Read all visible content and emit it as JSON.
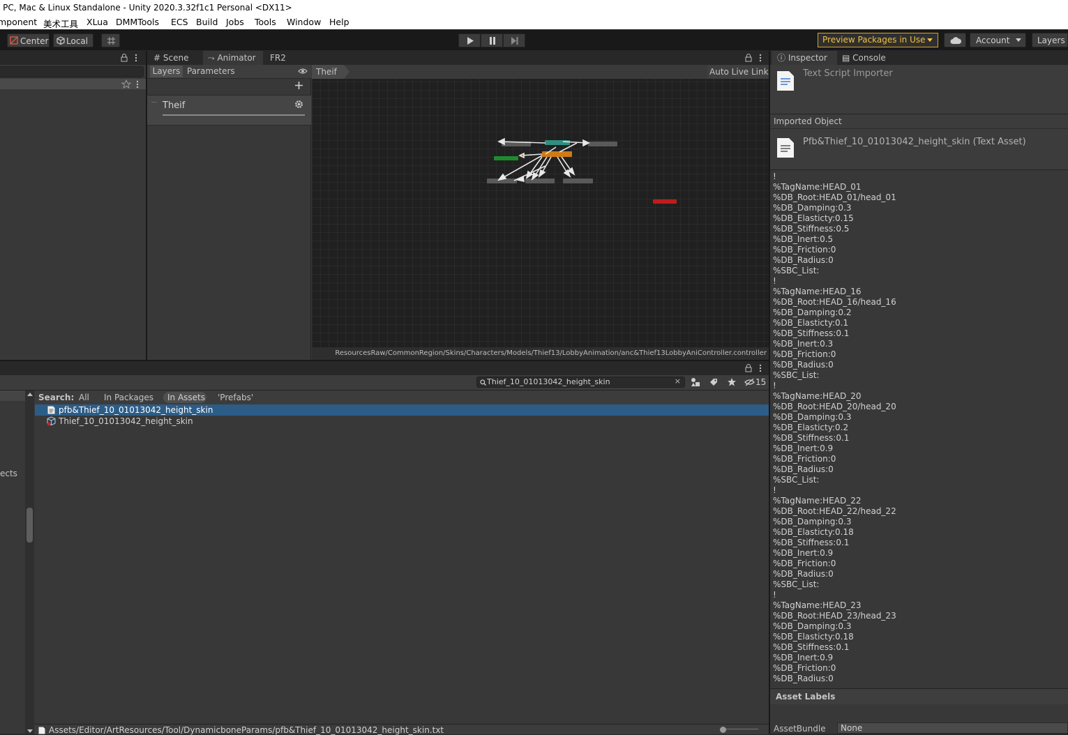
{
  "window": {
    "title": "- PC, Mac & Linux Standalone - Unity 2020.3.32f1c1 Personal <DX11>"
  },
  "menu": [
    "mponent",
    "美术工具",
    "XLua",
    "DMMTools",
    "ECS",
    "Build",
    "Jobs",
    "Tools",
    "Window",
    "Help"
  ],
  "toolbar": {
    "pivot_center": "Center",
    "pivot_local": "Local",
    "preview_packages": "Preview Packages in Use",
    "account": "Account",
    "layers": "Layers"
  },
  "animator": {
    "tabs": [
      "Scene",
      "Animator",
      "FR2"
    ],
    "subtabs": [
      "Layers",
      "Parameters"
    ],
    "layer_name": "Theif",
    "breadcrumb": "Theif",
    "auto_live_link": "Auto Live Link",
    "controller_path": "ResourcesRaw/CommonRegion/Skins/Characters/Models/Thief13/LobbyAnimation/anc&Thief13LobbyAniController.controller"
  },
  "project": {
    "search_value": "Thief_10_01013042_height_skin",
    "search_label": "Search:",
    "filters": [
      "All",
      "In Packages",
      "In Assets",
      "'Prefabs'"
    ],
    "active_filter": "In Assets",
    "hidden_count": "15",
    "results": [
      {
        "name": "pfb&Thief_10_01013042_height_skin",
        "icon": "text-file-icon",
        "selected": true
      },
      {
        "name": "Thief_10_01013042_height_skin",
        "icon": "prefab-icon",
        "selected": false
      }
    ],
    "left_partial_label": "ects",
    "status_path": "Assets/Editor/ArtResources/Tool/DynamicboneParams/pfb&Thief_10_01013042_height_skin.txt"
  },
  "inspector": {
    "tabs": [
      "Inspector",
      "Console"
    ],
    "importer_title": "Text Script Importer",
    "imported_object_label": "Imported Object",
    "asset_title": "Pfb&Thief_10_01013042_height_skin (Text Asset)",
    "content_lines": [
      "!",
      "%TagName:HEAD_01",
      "%DB_Root:HEAD_01/head_01",
      "%DB_Damping:0.3",
      "%DB_Elasticty:0.15",
      "%DB_Stiffness:0.5",
      "%DB_Inert:0.5",
      "%DB_Friction:0",
      "%DB_Radius:0",
      "%SBC_List:",
      "!",
      "%TagName:HEAD_16",
      "%DB_Root:HEAD_16/head_16",
      "%DB_Damping:0.2",
      "%DB_Elasticty:0.1",
      "%DB_Stiffness:0.1",
      "%DB_Inert:0.3",
      "%DB_Friction:0",
      "%DB_Radius:0",
      "%SBC_List:",
      "!",
      "%TagName:HEAD_20",
      "%DB_Root:HEAD_20/head_20",
      "%DB_Damping:0.3",
      "%DB_Elasticty:0.2",
      "%DB_Stiffness:0.1",
      "%DB_Inert:0.9",
      "%DB_Friction:0",
      "%DB_Radius:0",
      "%SBC_List:",
      "!",
      "%TagName:HEAD_22",
      "%DB_Root:HEAD_22/head_22",
      "%DB_Damping:0.3",
      "%DB_Elasticty:0.18",
      "%DB_Stiffness:0.1",
      "%DB_Inert:0.9",
      "%DB_Friction:0",
      "%DB_Radius:0",
      "%SBC_List:",
      "!",
      "%TagName:HEAD_23",
      "%DB_Root:HEAD_23/head_23",
      "%DB_Damping:0.3",
      "%DB_Elasticty:0.18",
      "%DB_Stiffness:0.1",
      "%DB_Inert:0.9",
      "%DB_Friction:0",
      "%DB_Radius:0"
    ],
    "asset_labels": "Asset Labels",
    "asset_bundle_label": "AssetBundle",
    "asset_bundle_value": "None"
  },
  "colors": {
    "accent_selection": "#2c5d87",
    "preview_warning": "#f2c040",
    "node_orange": "#d07a14",
    "node_teal": "#2f8f82",
    "node_green": "#1e8a2e",
    "node_red": "#c01c1c"
  }
}
